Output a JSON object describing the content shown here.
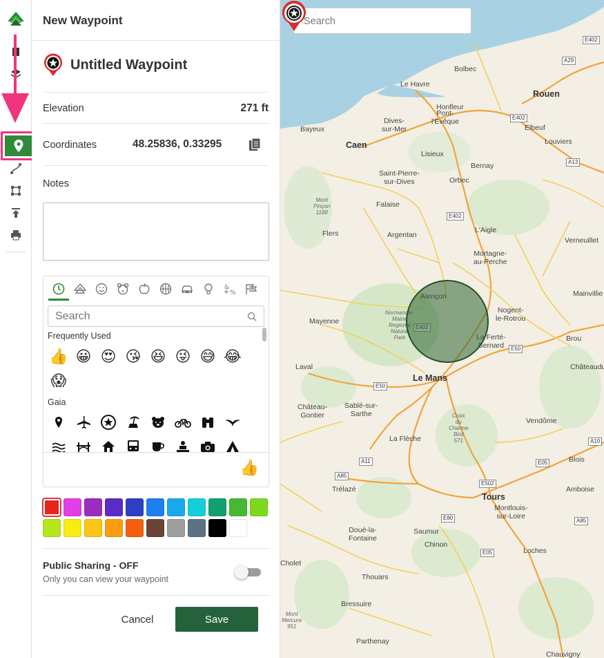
{
  "panel": {
    "header_title": "New Waypoint",
    "waypoint_title": "Untitled Waypoint",
    "elevation_label": "Elevation",
    "elevation_value": "271 ft",
    "coordinates_label": "Coordinates",
    "coordinates_value": "48.25836, 0.33295",
    "notes_label": "Notes",
    "notes_value": ""
  },
  "emoji_picker": {
    "search_placeholder": "Search",
    "tabs": [
      "recent-icon",
      "gaia-icon",
      "smileys-icon",
      "animals-icon",
      "food-icon",
      "activity-icon",
      "travel-icon",
      "objects-icon",
      "symbols-icon",
      "flags-icon"
    ],
    "frequently_used_label": "Frequently Used",
    "frequently_used": [
      "👍",
      "😀",
      "😍",
      "😘",
      "😆",
      "😜",
      "😅",
      "😂",
      "😱"
    ],
    "gaia_label": "Gaia",
    "gaia_icons": [
      "marker-icon",
      "airport-icon",
      "star-icon",
      "beach-icon",
      "bear-icon",
      "bicycle-icon",
      "binoculars-icon",
      "bird-icon",
      "water-icon",
      "bridge-icon",
      "house-icon",
      "bus-icon",
      "cafe-icon",
      "campsite-icon",
      "camera-icon",
      "tent-icon"
    ],
    "selected_preview": "👍"
  },
  "colors": {
    "row1": [
      "#e8251a",
      "#e13fe6",
      "#9b2dbf",
      "#5b2cc4",
      "#2f3fc3",
      "#1e7ff0",
      "#1aa8ec",
      "#13cfd9",
      "#13a071",
      "#48b832",
      "#7dd91e"
    ],
    "row2": [
      "#b4e61b",
      "#f9ec13",
      "#fbc516",
      "#fb9d0e",
      "#f2600f",
      "#6a4537",
      "#9e9e9e",
      "#5c7184",
      "#000000",
      "#ffffff"
    ],
    "selected": "#e8251a"
  },
  "sharing": {
    "title": "Public Sharing - OFF",
    "subtitle": "Only you can view your waypoint"
  },
  "buttons": {
    "cancel": "Cancel",
    "save": "Save"
  },
  "map": {
    "search_placeholder": "Search",
    "places": [
      {
        "name": "Le Havre",
        "size": "normal"
      },
      {
        "name": "Bolbec",
        "size": "normal"
      },
      {
        "name": "Honfleur",
        "size": "normal"
      },
      {
        "name": "Rouen",
        "size": "big"
      },
      {
        "name": "Dives-\nsur-Mer",
        "size": "normal"
      },
      {
        "name": "Pont-\nl'Évêque",
        "size": "normal"
      },
      {
        "name": "Elbeuf",
        "size": "normal"
      },
      {
        "name": "Bayeux",
        "size": "normal"
      },
      {
        "name": "Caen",
        "size": "big"
      },
      {
        "name": "Lisieux",
        "size": "normal"
      },
      {
        "name": "Louviers",
        "size": "normal"
      },
      {
        "name": "Bernay",
        "size": "normal"
      },
      {
        "name": "Saint-Pierre-\nsur-Dives",
        "size": "normal"
      },
      {
        "name": "Orbec",
        "size": "normal"
      },
      {
        "name": "Falaise",
        "size": "normal"
      },
      {
        "name": "L'Aigle",
        "size": "normal"
      },
      {
        "name": "Flers",
        "size": "normal"
      },
      {
        "name": "Argentan",
        "size": "normal"
      },
      {
        "name": "Verneuillet",
        "size": "normal"
      },
      {
        "name": "Mortagne-\nau-Perche",
        "size": "normal"
      },
      {
        "name": "Alençon",
        "size": "normal"
      },
      {
        "name": "Nogent-\nle-Rotrou",
        "size": "normal"
      },
      {
        "name": "Mainvillie",
        "size": "normal"
      },
      {
        "name": "Mayenne",
        "size": "normal"
      },
      {
        "name": "La Ferté-\nBernard",
        "size": "normal"
      },
      {
        "name": "Brou",
        "size": "normal"
      },
      {
        "name": "Châteaudun",
        "size": "normal"
      },
      {
        "name": "Laval",
        "size": "normal"
      },
      {
        "name": "Le Mans",
        "size": "big"
      },
      {
        "name": "Château-\nGontier",
        "size": "normal"
      },
      {
        "name": "Sablé-sur-\nSarthe",
        "size": "normal"
      },
      {
        "name": "Vendôme",
        "size": "normal"
      },
      {
        "name": "La Flèche",
        "size": "normal"
      },
      {
        "name": "Blois",
        "size": "normal"
      },
      {
        "name": "Trélazé",
        "size": "normal"
      },
      {
        "name": "Tours",
        "size": "big"
      },
      {
        "name": "Amboise",
        "size": "normal"
      },
      {
        "name": "Montlouis-\nsur-Loire",
        "size": "normal"
      },
      {
        "name": "Doué-la-\nFontaine",
        "size": "normal"
      },
      {
        "name": "Saumur",
        "size": "normal"
      },
      {
        "name": "Chinon",
        "size": "normal"
      },
      {
        "name": "Cholet",
        "size": "normal"
      },
      {
        "name": "Loches",
        "size": "normal"
      },
      {
        "name": "Thouars",
        "size": "normal"
      },
      {
        "name": "Bressuire",
        "size": "normal"
      },
      {
        "name": "Parthenay",
        "size": "normal"
      },
      {
        "name": "Chauvigny",
        "size": "normal"
      }
    ],
    "roads": [
      "E402",
      "A29",
      "E402",
      "A13",
      "E402",
      "E402",
      "E50",
      "E50",
      "A11",
      "A10",
      "A85",
      "E05",
      "E502",
      "E80",
      "A85",
      "E05"
    ],
    "terrain": [
      "Mont\nPinçon\n1188",
      "Normandie-\nMaine\nRegional\nNatural\nPark",
      "Croix\ndu\nCharme\nBird\n571",
      "Mont\nMercure\n951"
    ]
  }
}
